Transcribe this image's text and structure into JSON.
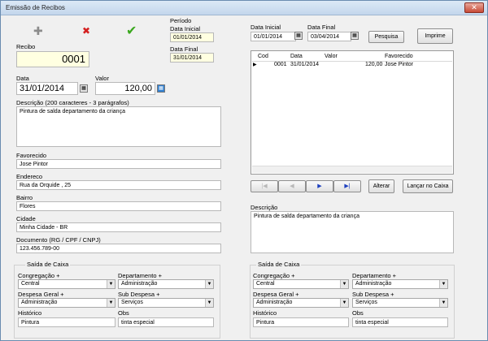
{
  "window": {
    "title": "Emissão de Recibos",
    "close_glyph": "✕"
  },
  "toolbar": {
    "add_icon": "plus-icon",
    "add_glyph": "✚",
    "delete_icon": "x-icon",
    "delete_glyph": "✖",
    "confirm_icon": "check-icon",
    "confirm_glyph": "✔"
  },
  "periodo": {
    "label": "Período",
    "inicial_label": "Data Inicial",
    "inicial_value": "01/01/2014",
    "final_label": "Data Final",
    "final_value": "31/01/2014"
  },
  "recibo": {
    "label": "Recibo",
    "value": "0001"
  },
  "data": {
    "label": "Data",
    "value": "31/01/2014"
  },
  "valor": {
    "label": "Valor",
    "value": "120,00"
  },
  "descricao": {
    "label": "Descrição (200 caracteres - 3 parágrafos)",
    "value": "Pintura de salda departamento da criança"
  },
  "favorecido": {
    "label": "Favorecido",
    "value": "Jose Pintor"
  },
  "endereco": {
    "label": "Endereco",
    "value": "Rua da Orquide , 25"
  },
  "bairro": {
    "label": "Bairro",
    "value": "Flores"
  },
  "cidade": {
    "label": "Cidade",
    "value": "Minha Cidade - BR"
  },
  "documento": {
    "label": "Documento (RG / CPF / CNPJ)",
    "value": "123.456.789-00"
  },
  "search": {
    "inicial_label": "Data Inicial",
    "inicial_value": "01/01/2014",
    "final_label": "Data Final",
    "final_value": "03/04/2014",
    "pesquisa_label": "Pesquisa",
    "imprime_label": "Imprime"
  },
  "grid": {
    "headers": [
      "Cod",
      "Data",
      "Valor",
      "Favorecido"
    ],
    "rows": [
      {
        "cod": "0001",
        "data": "31/01/2014",
        "valor": "120,00",
        "favorecido": "Jose Pintor"
      }
    ],
    "row_pointer": "▶"
  },
  "nav": {
    "first_glyph": "|◀",
    "prior_glyph": "◀",
    "next_glyph": "▶",
    "last_glyph": "▶|",
    "alterar_label": "Alterar",
    "lancar_label": "Lançar no Caixa"
  },
  "descricao2": {
    "label": "Descrição",
    "value": "Pintura de salda departamento da criança"
  },
  "saida_left": {
    "title": "Saída de Caixa",
    "congregacao_label": "Congregação +",
    "congregacao_value": "Central",
    "departamento_label": "Departamento +",
    "departamento_value": "Administração",
    "despesa_label": "Despesa Geral +",
    "despesa_value": "Administração",
    "sub_label": "Sub Despesa +",
    "sub_value": "Serviços",
    "historico_label": "Histórico",
    "historico_value": "Pintura",
    "obs_label": "Obs",
    "obs_value": "tinta especial"
  },
  "saida_right": {
    "title": "Saída de Caixa",
    "congregacao_label": "Congregação +",
    "congregacao_value": "Central",
    "departamento_label": "Departamento +",
    "departamento_value": "Administração",
    "despesa_label": "Despesa Geral +",
    "despesa_value": "Administração",
    "sub_label": "Sub Despesa +",
    "sub_value": "Serviços",
    "historico_label": "Histórico",
    "historico_value": "Pintura",
    "obs_label": "Obs",
    "obs_value": "tinta especial"
  },
  "glyphs": {
    "combo_arrow": "▼",
    "calendar": "▦"
  },
  "colors": {
    "add": "#8c8c8c",
    "delete": "#d42020",
    "confirm": "#3aa81e",
    "nav_active": "#1c3fbf",
    "nav_disabled": "#b8b8b8"
  }
}
